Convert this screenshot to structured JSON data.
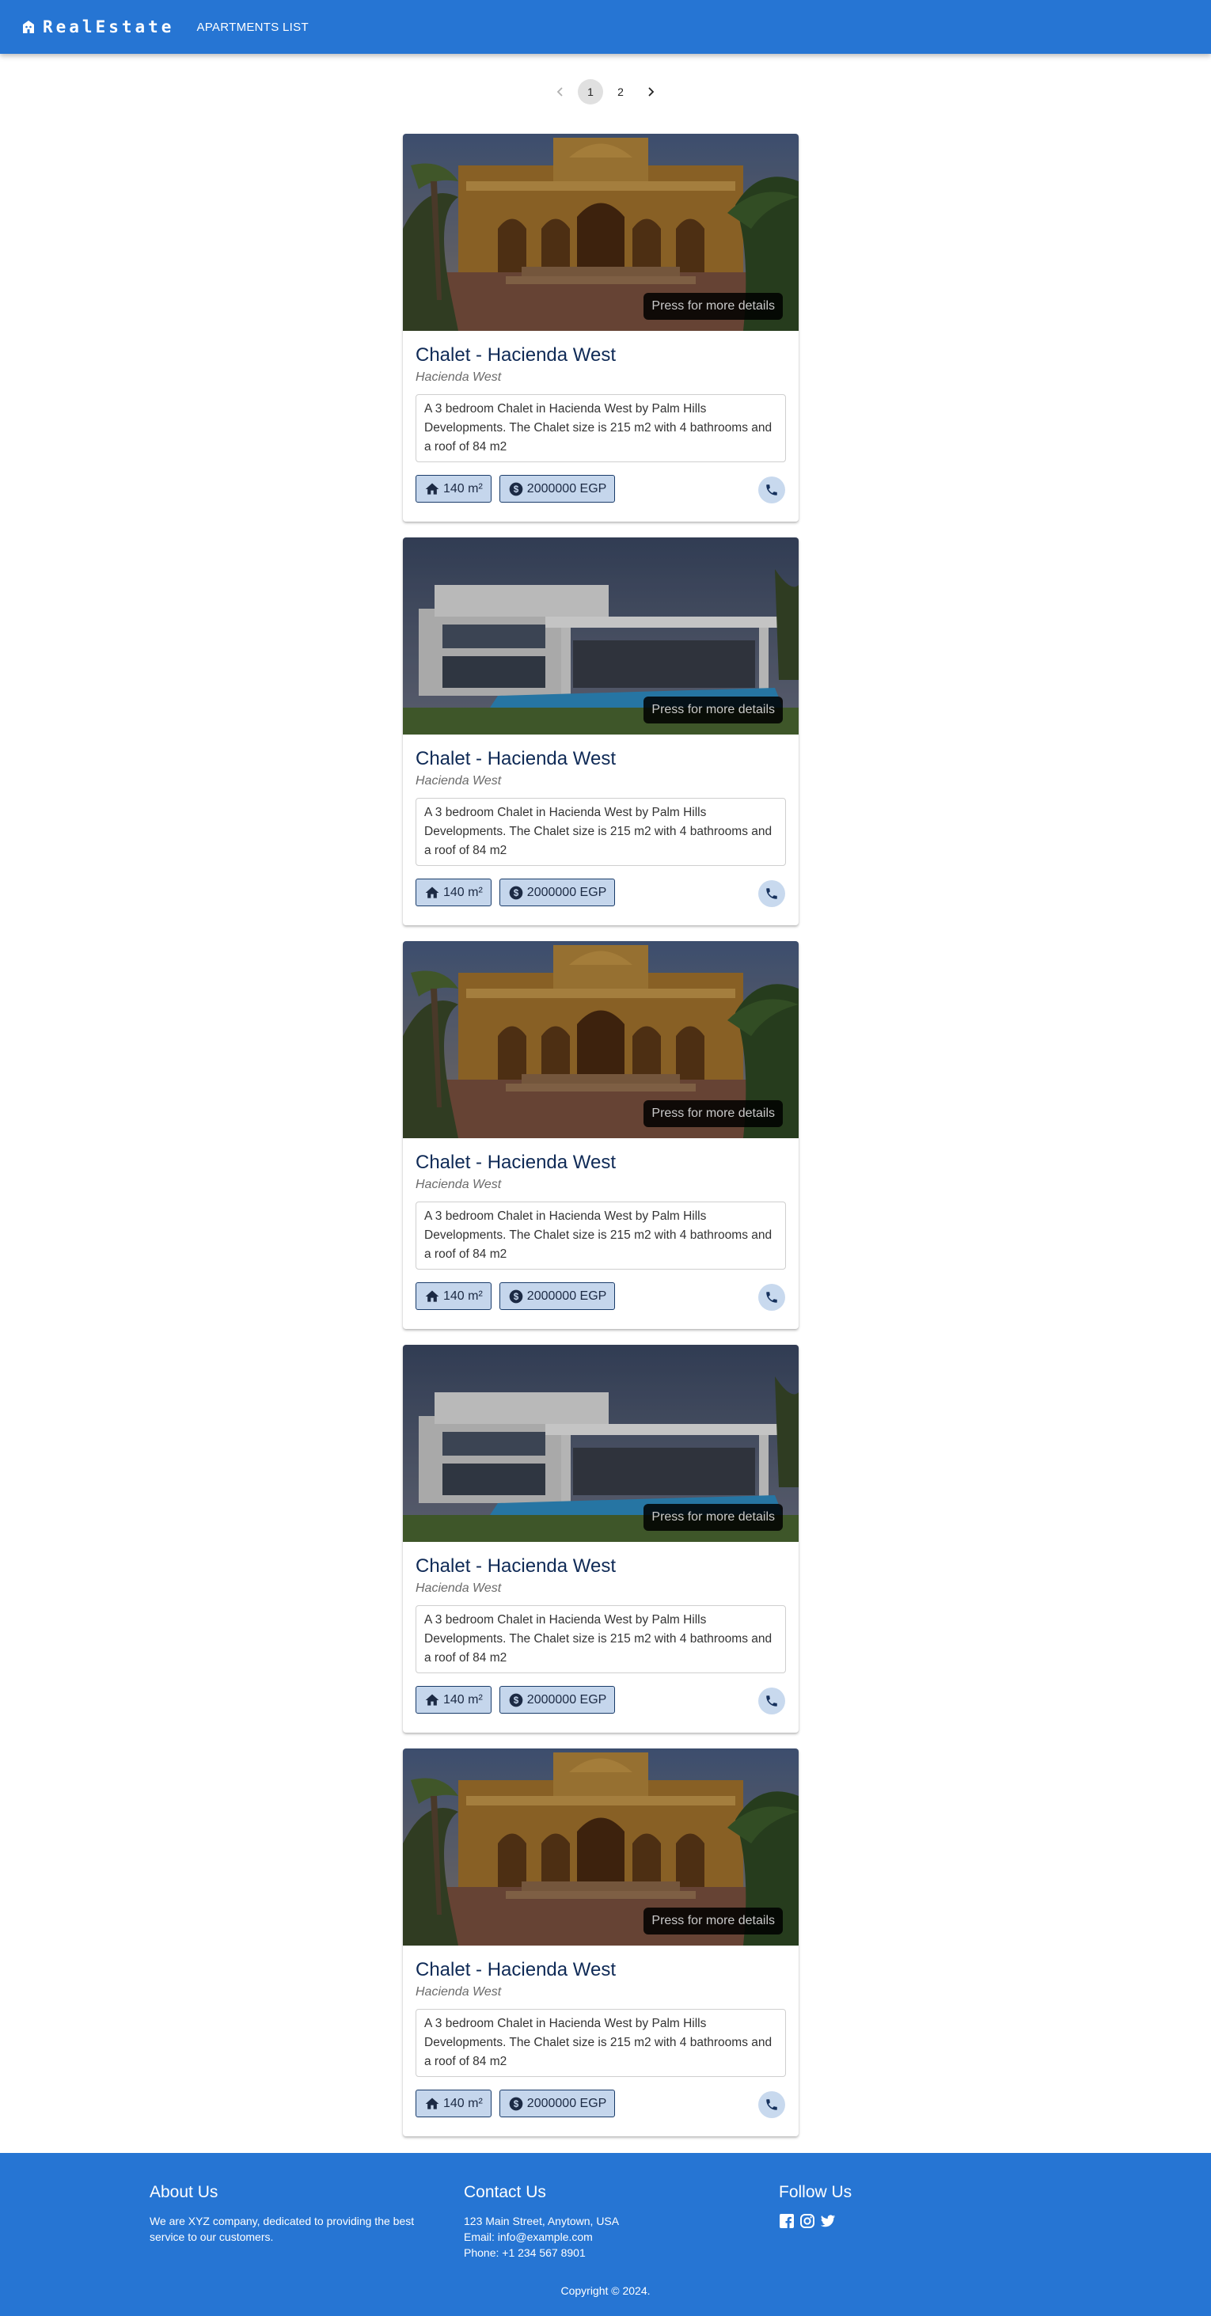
{
  "app": {
    "brand": "RealEstate",
    "nav_link": "APARTMENTS LIST",
    "colors": {
      "primary": "#2675d3",
      "title": "#0f2a56",
      "chip_bg": "#c5d6ec"
    }
  },
  "pagination": {
    "pages": [
      "1",
      "2"
    ],
    "current": "1",
    "prev_icon": "chevron-left-icon",
    "next_icon": "chevron-right-icon"
  },
  "listings": [
    {
      "image": "hacienda-villa-photo",
      "overlay": "Press for more details",
      "title": "Chalet - Hacienda West",
      "location": "Hacienda West",
      "description": "A 3 bedroom Chalet in Hacienda West by Palm Hills Developments. The Chalet size is 215 m2 with 4 bathrooms and a roof of 84 m2",
      "area": "140 m²",
      "price": "2000000 EGP"
    },
    {
      "image": "modern-villa-pool-photo",
      "overlay": "Press for more details",
      "title": "Chalet - Hacienda West",
      "location": "Hacienda West",
      "description": "A 3 bedroom Chalet in Hacienda West by Palm Hills Developments. The Chalet size is 215 m2 with 4 bathrooms and a roof of 84 m2",
      "area": "140 m²",
      "price": "2000000 EGP"
    },
    {
      "image": "hacienda-villa-photo",
      "overlay": "Press for more details",
      "title": "Chalet - Hacienda West",
      "location": "Hacienda West",
      "description": "A 3 bedroom Chalet in Hacienda West by Palm Hills Developments. The Chalet size is 215 m2 with 4 bathrooms and a roof of 84 m2",
      "area": "140 m²",
      "price": "2000000 EGP"
    },
    {
      "image": "modern-villa-pool-photo",
      "overlay": "Press for more details",
      "title": "Chalet - Hacienda West",
      "location": "Hacienda West",
      "description": "A 3 bedroom Chalet in Hacienda West by Palm Hills Developments. The Chalet size is 215 m2 with 4 bathrooms and a roof of 84 m2",
      "area": "140 m²",
      "price": "2000000 EGP"
    },
    {
      "image": "hacienda-villa-photo",
      "overlay": "Press for more details",
      "title": "Chalet - Hacienda West",
      "location": "Hacienda West",
      "description": "A 3 bedroom Chalet in Hacienda West by Palm Hills Developments. The Chalet size is 215 m2 with 4 bathrooms and a roof of 84 m2",
      "area": "140 m²",
      "price": "2000000 EGP"
    }
  ],
  "footer": {
    "about_title": "About Us",
    "about_text": "We are XYZ company, dedicated to providing the best service to our customers.",
    "contact_title": "Contact Us",
    "address": "123 Main Street, Anytown, USA",
    "email": "Email: info@example.com",
    "phone": "Phone: +1 234 567 8901",
    "follow_title": "Follow Us",
    "social_icons": [
      "facebook-icon",
      "instagram-icon",
      "twitter-icon"
    ],
    "copyright": "Copyright © 2024."
  }
}
